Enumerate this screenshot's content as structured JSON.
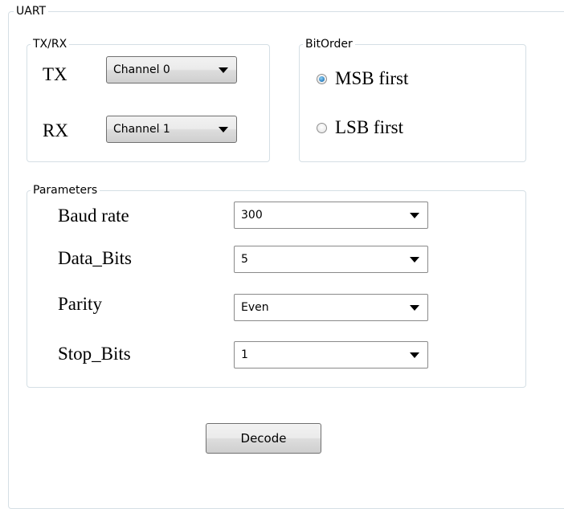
{
  "uart": {
    "legend": "UART",
    "txrx": {
      "legend": "TX/RX",
      "tx_label": "TX",
      "tx_value": "Channel 0",
      "rx_label": "RX",
      "rx_value": "Channel 1"
    },
    "bitorder": {
      "legend": "BitOrder",
      "options": [
        {
          "label": "MSB first",
          "selected": true
        },
        {
          "label": "LSB first",
          "selected": false
        }
      ]
    },
    "parameters": {
      "legend": "Parameters",
      "rows": [
        {
          "label": "Baud rate",
          "value": "300"
        },
        {
          "label": "Data_Bits",
          "value": "5"
        },
        {
          "label": "Parity",
          "value": "Even"
        },
        {
          "label": "Stop_Bits",
          "value": "1"
        }
      ]
    },
    "decode_label": "Decode"
  },
  "colors": {
    "group_border": "#d5dfe5",
    "radio_selected": "#2a7fc0"
  }
}
